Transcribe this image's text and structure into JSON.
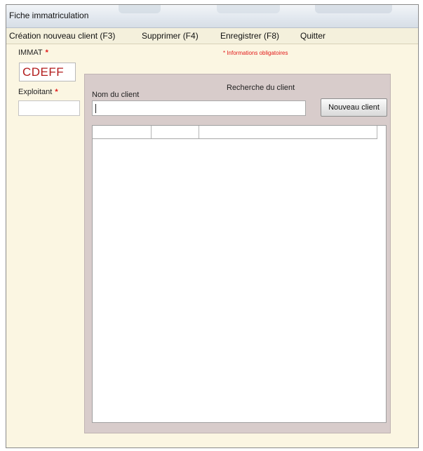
{
  "window": {
    "title": "Fiche immatriculation"
  },
  "menu": [
    {
      "label": "Création nouveau client (F3)"
    },
    {
      "label": "Supprimer (F4)"
    },
    {
      "label": "Enregistrer (F8)"
    },
    {
      "label": "Quitter"
    }
  ],
  "form": {
    "immat_label": "IMMAT",
    "required_mark": "*",
    "immat_value": "CDEFF",
    "exploitant_label": "Exploitant",
    "exploitant_value": "",
    "required_note": "* Informations obligatoires"
  },
  "search": {
    "title": "Recherche du client",
    "name_label": "Nom du client",
    "name_value": "",
    "new_client_button": "Nouveau client"
  },
  "results_grid": {
    "columns": [
      "",
      "",
      ""
    ],
    "rows": []
  },
  "colors": {
    "required": "#e21818",
    "immat_text": "#b21c1c",
    "panel_bg": "#d8cccb",
    "form_bg": "#fbf6e2"
  }
}
